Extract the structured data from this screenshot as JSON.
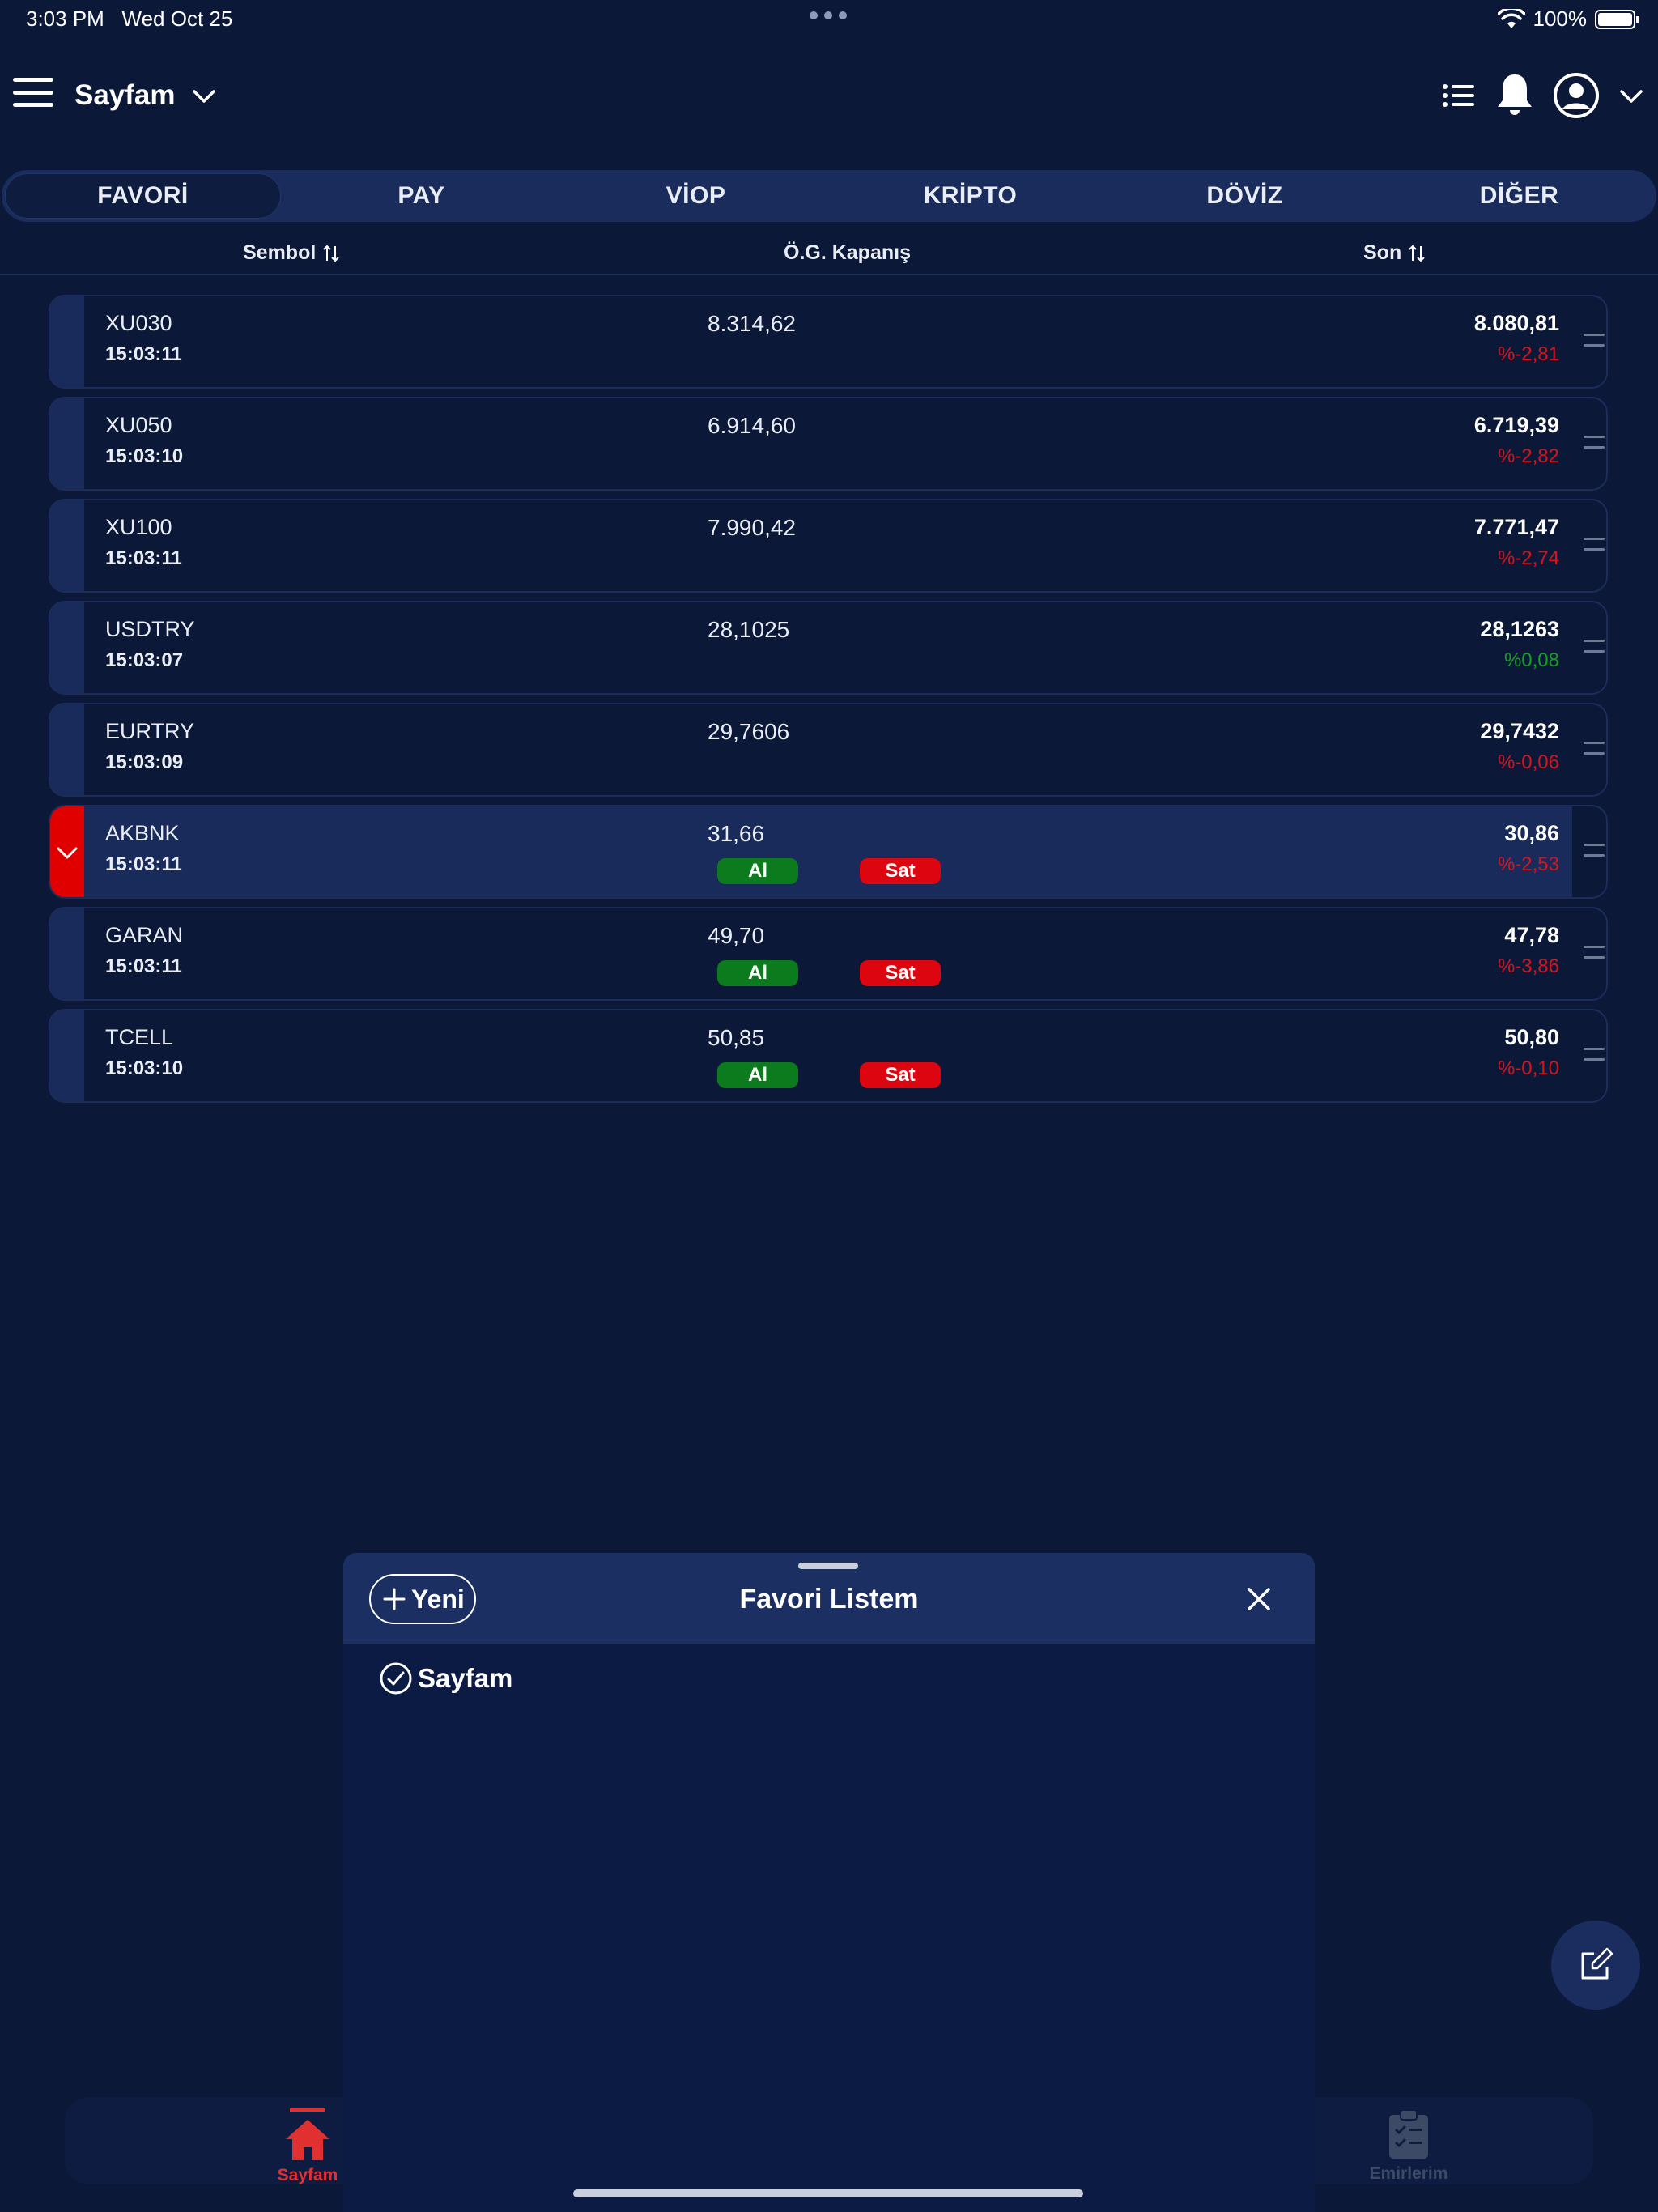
{
  "status": {
    "time": "3:03 PM",
    "date": "Wed Oct 25",
    "battery": "100%"
  },
  "header": {
    "title": "Sayfam"
  },
  "tabs": [
    {
      "label": "FAVORİ",
      "active": true
    },
    {
      "label": "PAY",
      "active": false
    },
    {
      "label": "VİOP",
      "active": false
    },
    {
      "label": "KRİPTO",
      "active": false
    },
    {
      "label": "DÖVİZ",
      "active": false
    },
    {
      "label": "DİĞER",
      "active": false
    }
  ],
  "columns": {
    "symbol": "Sembol",
    "prev_close": "Ö.G. Kapanış",
    "last": "Son"
  },
  "rows": [
    {
      "symbol": "XU030",
      "time": "15:03:11",
      "prev_close": "8.314,62",
      "last": "8.080,81",
      "change": "%-2,81",
      "direction": "down"
    },
    {
      "symbol": "XU050",
      "time": "15:03:10",
      "prev_close": "6.914,60",
      "last": "6.719,39",
      "change": "%-2,82",
      "direction": "down"
    },
    {
      "symbol": "XU100",
      "time": "15:03:11",
      "prev_close": "7.990,42",
      "last": "7.771,47",
      "change": "%-2,74",
      "direction": "down"
    },
    {
      "symbol": "USDTRY",
      "time": "15:03:07",
      "prev_close": "28,1025",
      "last": "28,1263",
      "change": "%0,08",
      "direction": "up"
    },
    {
      "symbol": "EURTRY",
      "time": "15:03:09",
      "prev_close": "29,7606",
      "last": "29,7432",
      "change": "%-0,06",
      "direction": "down"
    },
    {
      "symbol": "AKBNK",
      "time": "15:03:11",
      "prev_close": "31,66",
      "last": "30,86",
      "change": "%-2,53",
      "direction": "down"
    },
    {
      "symbol": "GARAN",
      "time": "15:03:11",
      "prev_close": "49,70",
      "last": "47,78",
      "change": "%-3,86",
      "direction": "down"
    },
    {
      "symbol": "TCELL",
      "time": "15:03:10",
      "prev_close": "50,85",
      "last": "50,80",
      "change": "%-0,10",
      "direction": "down"
    }
  ],
  "trade_buttons": {
    "buy": "Al",
    "sell": "Sat"
  },
  "bottom_nav": {
    "home": "Sayfam",
    "orders": "Emirlerim"
  },
  "sheet": {
    "new_button": "Yeni",
    "title": "Favori Listem",
    "items": [
      "Sayfam"
    ]
  },
  "colors": {
    "background": "#0b1838",
    "negative": "#d8141b",
    "positive": "#13a023",
    "buy": "#0b7b1d",
    "sell": "#dd0610"
  }
}
